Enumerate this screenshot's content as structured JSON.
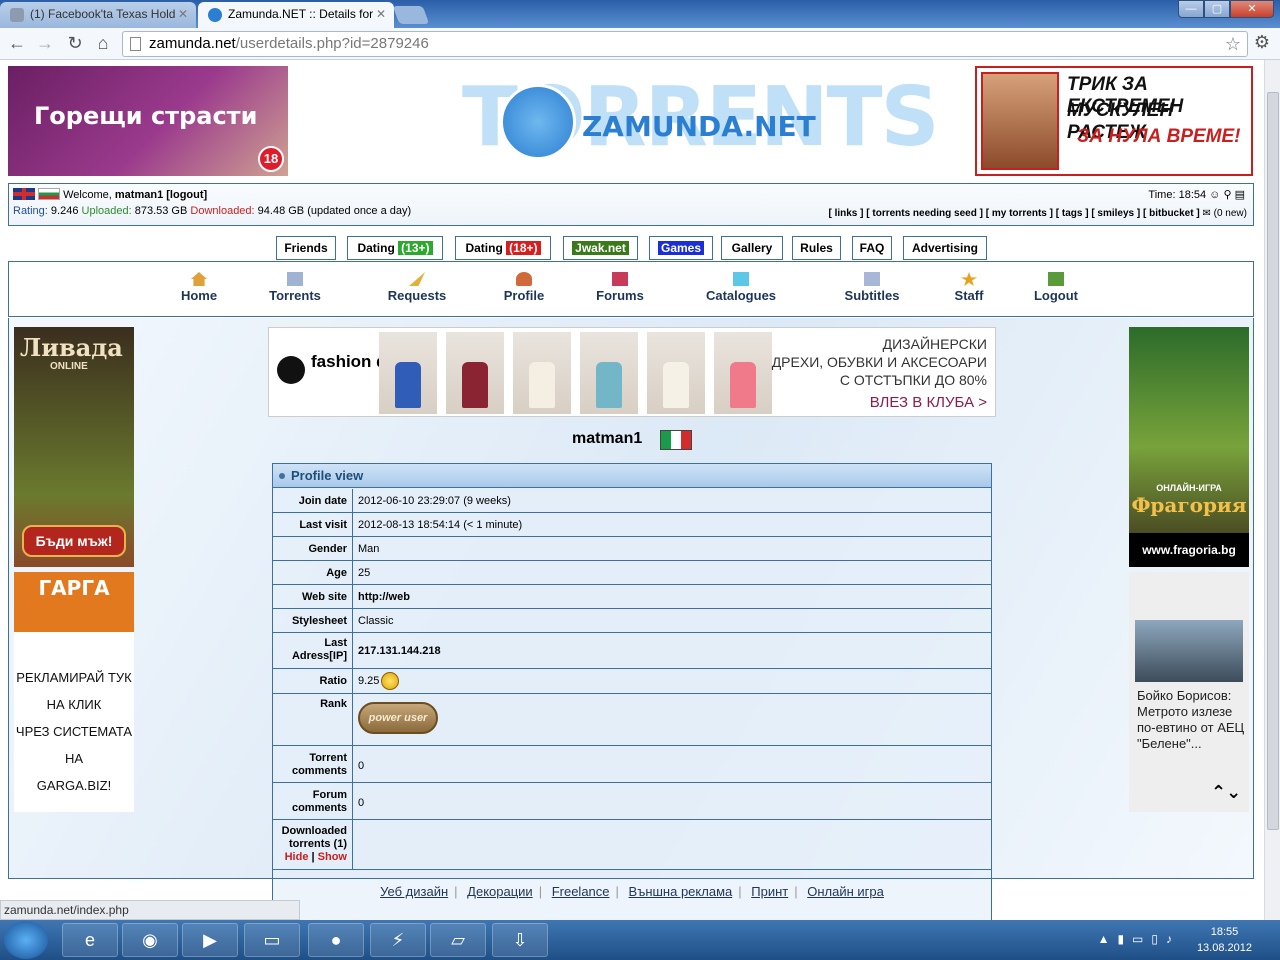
{
  "browser": {
    "tabs": [
      {
        "title": "(1) Facebook'ta Texas Hold",
        "active": false
      },
      {
        "title": "Zamunda.NET :: Details for",
        "active": true
      }
    ],
    "url_domain": "zamunda.net",
    "url_path": "/userdetails.php?id=2879246",
    "status_url": "zamunda.net/index.php"
  },
  "banners": {
    "left_text": "Горещи страсти",
    "left_age": "18",
    "logo_text": "ZAMUNDA.NET",
    "logo_bg": "TORRENTS",
    "right_lines": [
      "ТРИК ЗА ЕКСТРЕМЕН",
      "МУСКУЛЕН РАСТЕЖ",
      "ЗА НУЛА ВРЕМЕ!"
    ]
  },
  "userbar": {
    "welcome": "Welcome,",
    "username": "matman1",
    "logout": "[logout]",
    "rating_label": "Rating:",
    "rating": "9.246",
    "uploaded_label": "Uploaded:",
    "uploaded": "873.53 GB",
    "downloaded_label": "Downloaded:",
    "downloaded": "94.48 GB",
    "updated_note": "(updated once a day)",
    "time_label": "Time:",
    "time": "18:54",
    "links": [
      "[ links ]",
      "[ torrents needing seed ]",
      "[ my torrents ]",
      "[ tags ]",
      "[ smileys ]",
      "[ bitbucket ]"
    ],
    "messages": "(0 new)"
  },
  "topnav": [
    {
      "label": "Friends"
    },
    {
      "label": "Dating",
      "pill": "(13+)",
      "pill_color": "#2ea82e"
    },
    {
      "label": "Dating",
      "pill": "(18+)",
      "pill_color": "#d81f1f"
    },
    {
      "label": "",
      "pill": "Jwak.net",
      "pill_color": "#3a7a1a"
    },
    {
      "label": "",
      "pill": "Games",
      "pill_color": "#1a2fd8"
    },
    {
      "label": "Gallery"
    },
    {
      "label": "Rules"
    },
    {
      "label": "FAQ"
    },
    {
      "label": "Advertising"
    }
  ],
  "mainnav": [
    "Home",
    "Torrents",
    "Requests",
    "Profile",
    "Forums",
    "Catalogues",
    "Subtitles",
    "Staff",
    "Logout"
  ],
  "ads": {
    "left1_title": "Ливада",
    "left1_sub": "ONLINE",
    "left1_button": "Бъди мъж!",
    "left2_brand": "ГАРГА",
    "left2_lines": [
      "РЕКЛАМИРАЙ ТУК",
      "НА КЛИК",
      "ЧРЕЗ СИСТЕМАТА НА",
      "GARGA.BIZ!"
    ],
    "fashion_brand": "fashion days",
    "fashion_lines": [
      "ДИЗАЙНЕРСКИ",
      "ДРЕХИ, ОБУВКИ И АКСЕСОАРИ",
      "С ОТСТЪПКИ ДО 80%"
    ],
    "fashion_cta": "ВЛЕЗ В КЛУБА >",
    "right1_game": "ОНЛАЙН-ИГРА",
    "right1_name": "Фрагория",
    "right1_url": "www.fragoria.bg",
    "news_text": "Бойко Борисов: Метрото излезе по-евтино от АЕЦ \"Белене\"..."
  },
  "profile": {
    "username": "matman1",
    "header": "Profile view",
    "rows": [
      {
        "label": "Join date",
        "value": "2012-06-10 23:29:07 (9 weeks)"
      },
      {
        "label": "Last visit",
        "value": "2012-08-13 18:54:14 (< 1 minute)"
      },
      {
        "label": "Gender",
        "value": "Man"
      },
      {
        "label": "Age",
        "value": "25"
      },
      {
        "label": "Web site",
        "value": "http://web"
      },
      {
        "label": "Stylesheet",
        "value": "Classic"
      },
      {
        "label": "Last Adress[IP]",
        "value": "217.131.144.218"
      },
      {
        "label": "Ratio",
        "value": "9.25"
      },
      {
        "label": "Rank",
        "value": "power user"
      },
      {
        "label": "Torrent comments",
        "value": "0"
      },
      {
        "label": "Forum comments",
        "value": "0"
      },
      {
        "label": "Downloaded torrents (1)",
        "value": ""
      }
    ],
    "hide": "Hide",
    "show": "Show"
  },
  "footer": [
    "Уеб дизайн",
    "Декорации",
    "Freelance",
    "Външна реклама",
    "Принт",
    "Онлайн игра"
  ],
  "taskbar": {
    "time": "18:55",
    "date": "13.08.2012"
  }
}
